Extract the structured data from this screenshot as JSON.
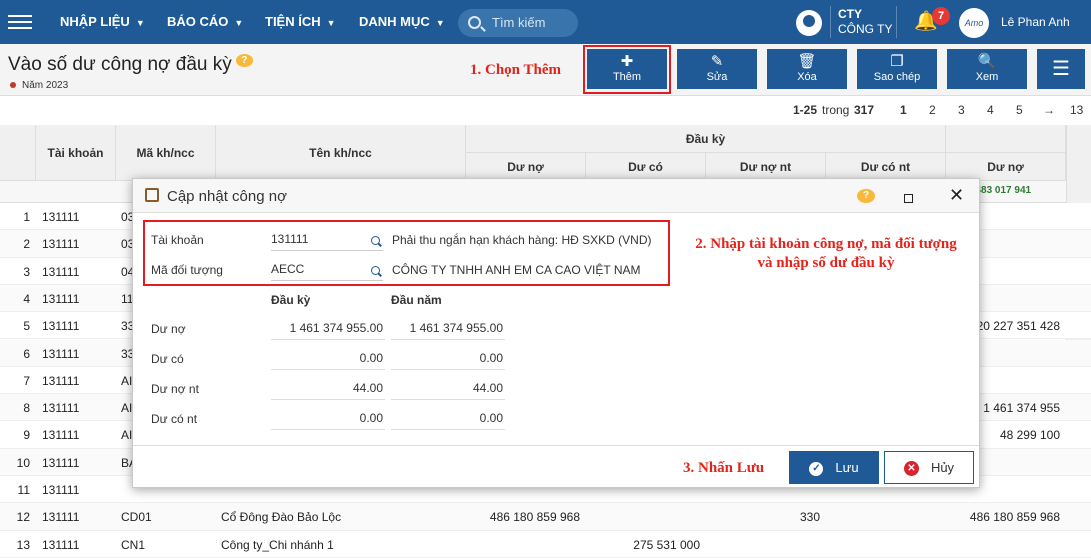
{
  "topbar": {
    "menu": [
      "NHẬP LIỆU",
      "BÁO CÁO",
      "TIỆN ÍCH",
      "DANH MỤC"
    ],
    "search_placeholder": "Tìm kiếm",
    "company_line1": "CTY",
    "company_line2": "CÔNG TY",
    "notification_count": "7",
    "user_name": "Lê Phan Anh"
  },
  "page": {
    "title": "Vào số dư công nợ đầu kỳ",
    "year": "Năm 2023"
  },
  "toolbar": {
    "add": "Thêm",
    "edit": "Sửa",
    "delete": "Xóa",
    "copy": "Sao chép",
    "view": "Xem"
  },
  "annotations": {
    "step1": "1. Chọn Thêm",
    "step2_line1": "2. Nhập tài khoản công nợ, mã đối tượng",
    "step2_line2": "và nhập số dư đầu kỳ",
    "step3": "3. Nhấn Lưu"
  },
  "pager": {
    "range": "1-25",
    "of": "trong",
    "total": "317",
    "pages": [
      "1",
      "2",
      "3",
      "4",
      "5"
    ],
    "next": "→",
    "last": "13"
  },
  "grid": {
    "headers": {
      "account": "Tài khoản",
      "code": "Mã kh/ncc",
      "name": "Tên kh/ncc",
      "group_opening": "Đầu kỳ",
      "debit": "Dư nợ",
      "credit": "Dư có",
      "debit_nt": "Dư nợ nt",
      "credit_nt": "Dư có nt",
      "debit2": "Dư nợ"
    },
    "total_debit2": "353 483 017 941",
    "rows": [
      {
        "n": "1",
        "acc": "131111",
        "code": "03",
        "name": "",
        "debit": "",
        "credit": "",
        "dnt": "",
        "cnt": "",
        "d2": ""
      },
      {
        "n": "2",
        "acc": "131111",
        "code": "03",
        "name": "",
        "debit": "",
        "credit": "",
        "dnt": "",
        "cnt": "",
        "d2": ""
      },
      {
        "n": "3",
        "acc": "131111",
        "code": "04",
        "name": "",
        "debit": "",
        "credit": "",
        "dnt": "",
        "cnt": "",
        "d2": ""
      },
      {
        "n": "4",
        "acc": "131111",
        "code": "11",
        "name": "",
        "debit": "",
        "credit": "",
        "dnt": "",
        "cnt": "",
        "d2": ""
      },
      {
        "n": "5",
        "acc": "131111",
        "code": "33",
        "name": "",
        "debit": "",
        "credit": "",
        "dnt": "",
        "cnt": "",
        "d2": "20 227 351 428"
      },
      {
        "n": "6",
        "acc": "131111",
        "code": "33",
        "name": "",
        "debit": "",
        "credit": "",
        "dnt": "",
        "cnt": "",
        "d2": ""
      },
      {
        "n": "7",
        "acc": "131111",
        "code": "AI",
        "name": "",
        "debit": "",
        "credit": "",
        "dnt": "",
        "cnt": "",
        "d2": ""
      },
      {
        "n": "8",
        "acc": "131111",
        "code": "AI",
        "name": "",
        "debit": "",
        "credit": "",
        "dnt": "",
        "cnt": "",
        "d2": "1 461 374 955"
      },
      {
        "n": "9",
        "acc": "131111",
        "code": "AI",
        "name": "",
        "debit": "",
        "credit": "",
        "dnt": "",
        "cnt": "",
        "d2": "48 299 100"
      },
      {
        "n": "10",
        "acc": "131111",
        "code": "BA",
        "name": "",
        "debit": "",
        "credit": "",
        "dnt": "",
        "cnt": "",
        "d2": ""
      },
      {
        "n": "11",
        "acc": "131111",
        "code": "",
        "name": "",
        "debit": "",
        "credit": "",
        "dnt": "",
        "cnt": "",
        "d2": ""
      },
      {
        "n": "12",
        "acc": "131111",
        "code": "CD01",
        "name": "Cổ Đông Đào Bảo Lộc",
        "debit": "486 180 859 968",
        "credit": "",
        "dnt": "330",
        "cnt": "",
        "d2": "486 180 859 968"
      },
      {
        "n": "13",
        "acc": "131111",
        "code": "CN1",
        "name": "Công ty_Chi nhánh 1",
        "debit": "",
        "credit": "275 531 000",
        "dnt": "",
        "cnt": "",
        "d2": ""
      }
    ]
  },
  "dialog": {
    "title": "Cập nhật công nợ",
    "account_label": "Tài khoản",
    "account_value": "131111",
    "account_desc": "Phải thu ngắn hạn khách hàng: HĐ SXKD (VND)",
    "object_label": "Mã đối tượng",
    "object_value": "AECC",
    "object_desc": "CÔNG TY TNHH ANH EM CA CAO VIỆT NAM",
    "col_period": "Đầu kỳ",
    "col_year": "Đầu năm",
    "lines": [
      {
        "label": "Dư nợ",
        "period": "1 461 374 955.00",
        "year": "1 461 374 955.00"
      },
      {
        "label": "Dư có",
        "period": "0.00",
        "year": "0.00"
      },
      {
        "label": "Dư nợ nt",
        "period": "44.00",
        "year": "44.00"
      },
      {
        "label": "Dư có nt",
        "period": "0.00",
        "year": "0.00"
      }
    ],
    "save": "Lưu",
    "cancel": "Hủy"
  }
}
